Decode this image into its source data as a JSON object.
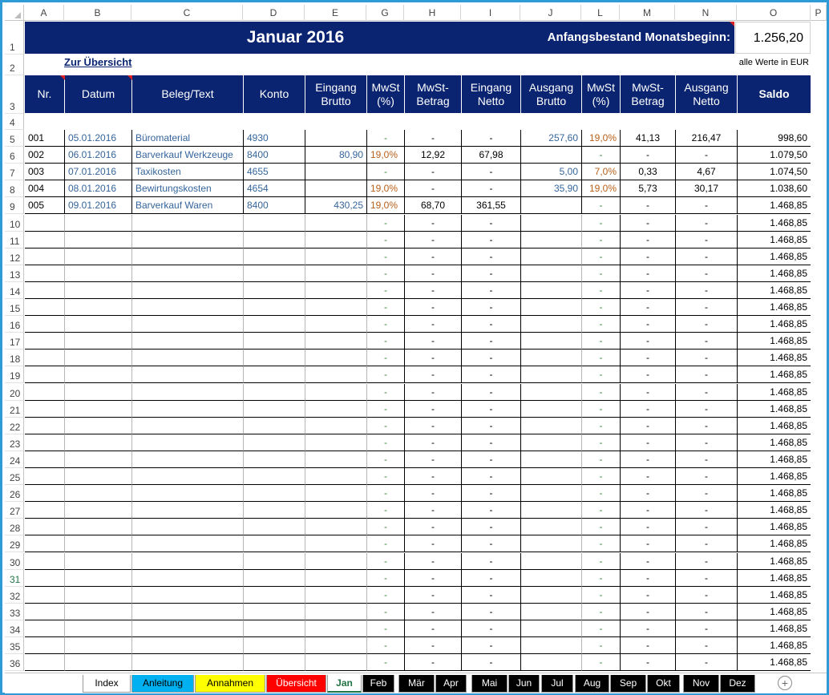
{
  "columns": [
    "A",
    "B",
    "C",
    "D",
    "E",
    "G",
    "H",
    "I",
    "J",
    "L",
    "M",
    "N",
    "O",
    "P"
  ],
  "rows": [
    "1",
    "2",
    "3",
    "4",
    "5",
    "6",
    "7",
    "8",
    "9",
    "10",
    "11",
    "12",
    "13",
    "14",
    "15",
    "16",
    "17",
    "18",
    "19",
    "20",
    "21",
    "22",
    "23",
    "24",
    "25",
    "26",
    "27",
    "28",
    "29",
    "30",
    "31",
    "32",
    "33",
    "34",
    "35",
    "36"
  ],
  "title": "Januar 2016",
  "opening": {
    "label": "Anfangsbestand Monatsbeginn:",
    "value": "1.256,20"
  },
  "overview_link": "Zur Übersicht",
  "currency_note": "alle Werte in EUR",
  "headers": {
    "nr": "Nr.",
    "datum": "Datum",
    "beleg": "Beleg/Text",
    "konto": "Konto",
    "eingang_brutto": "Eingang\nBrutto",
    "mwst_in": "MwSt\n(%)",
    "mwst_betrag_in": "MwSt-\nBetrag",
    "eingang_netto": "Eingang\nNetto",
    "ausgang_brutto": "Ausgang\nBrutto",
    "mwst_out": "MwSt\n(%)",
    "mwst_betrag_out": "MwSt-\nBetrag",
    "ausgang_netto": "Ausgang\nNetto",
    "saldo": "Saldo"
  },
  "entries": [
    {
      "nr": "001",
      "datum": "05.01.2016",
      "beleg": "Büromaterial",
      "konto": "4930",
      "eingang_brutto": "",
      "mwst_in": "-",
      "mwst_betrag_in": "-",
      "eingang_netto": "-",
      "ausgang_brutto": "257,60",
      "mwst_out": "19,0%",
      "mwst_betrag_out": "41,13",
      "ausgang_netto": "216,47",
      "saldo": "998,60"
    },
    {
      "nr": "002",
      "datum": "06.01.2016",
      "beleg": "Barverkauf Werkzeuge",
      "konto": "8400",
      "eingang_brutto": "80,90",
      "mwst_in": "19,0%",
      "mwst_betrag_in": "12,92",
      "eingang_netto": "67,98",
      "ausgang_brutto": "",
      "mwst_out": "-",
      "mwst_betrag_out": "-",
      "ausgang_netto": "-",
      "saldo": "1.079,50"
    },
    {
      "nr": "003",
      "datum": "07.01.2016",
      "beleg": "Taxikosten",
      "konto": "4655",
      "eingang_brutto": "",
      "mwst_in": "-",
      "mwst_betrag_in": "-",
      "eingang_netto": "-",
      "ausgang_brutto": "5,00",
      "mwst_out": "7,0%",
      "mwst_betrag_out": "0,33",
      "ausgang_netto": "4,67",
      "saldo": "1.074,50"
    },
    {
      "nr": "004",
      "datum": "08.01.2016",
      "beleg": "Bewirtungskosten",
      "konto": "4654",
      "eingang_brutto": "",
      "mwst_in": "19,0%",
      "mwst_betrag_in": "-",
      "eingang_netto": "-",
      "ausgang_brutto": "35,90",
      "mwst_out": "19,0%",
      "mwst_betrag_out": "5,73",
      "ausgang_netto": "30,17",
      "saldo": "1.038,60"
    },
    {
      "nr": "005",
      "datum": "09.01.2016",
      "beleg": "Barverkauf Waren",
      "konto": "8400",
      "eingang_brutto": "430,25",
      "mwst_in": "19,0%",
      "mwst_betrag_in": "68,70",
      "eingang_netto": "361,55",
      "ausgang_brutto": "",
      "mwst_out": "-",
      "mwst_betrag_out": "-",
      "ausgang_netto": "-",
      "saldo": "1.468,85"
    }
  ],
  "empty_row": {
    "dash": "-",
    "saldo": "1.468,85"
  },
  "tabs": [
    {
      "label": "Index",
      "bg": "#ffffff",
      "fg": "#000000"
    },
    {
      "label": "Anleitung",
      "bg": "#00b0f0",
      "fg": "#000000"
    },
    {
      "label": "Annahmen",
      "bg": "#ffff00",
      "fg": "#000000"
    },
    {
      "label": "Übersicht",
      "bg": "#ff0000",
      "fg": "#ffffff"
    },
    {
      "label": "Jan",
      "bg": "#ffffff",
      "fg": "#217346",
      "active": true
    },
    {
      "label": "Feb",
      "bg": "#000000",
      "fg": "#ffffff"
    },
    {
      "label": "Mär",
      "bg": "#000000",
      "fg": "#ffffff"
    },
    {
      "label": "Apr",
      "bg": "#000000",
      "fg": "#ffffff"
    },
    {
      "label": "Mai",
      "bg": "#000000",
      "fg": "#ffffff"
    },
    {
      "label": "Jun",
      "bg": "#000000",
      "fg": "#ffffff"
    },
    {
      "label": "Jul",
      "bg": "#000000",
      "fg": "#ffffff"
    },
    {
      "label": "Aug",
      "bg": "#000000",
      "fg": "#ffffff"
    },
    {
      "label": "Sep",
      "bg": "#000000",
      "fg": "#ffffff"
    },
    {
      "label": "Okt",
      "bg": "#000000",
      "fg": "#ffffff"
    },
    {
      "label": "Nov",
      "bg": "#000000",
      "fg": "#ffffff"
    },
    {
      "label": "Dez",
      "bg": "#000000",
      "fg": "#ffffff"
    }
  ],
  "add_sheet_icon": "plus-circle-icon",
  "colors": {
    "header_navy": "#0a2472",
    "accent_orange": "#b8601b",
    "accent_blue": "#35659c",
    "frame_blue": "#2e9bd6"
  }
}
